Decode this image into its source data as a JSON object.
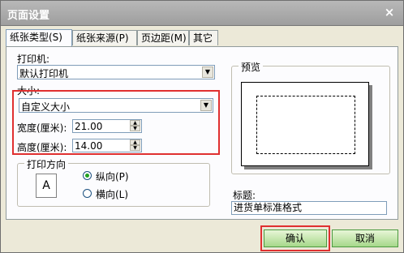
{
  "window": {
    "title": "页面设置",
    "close_glyph": "×"
  },
  "tabs": [
    {
      "label": "纸张类型(S)"
    },
    {
      "label": "纸张来源(P)"
    },
    {
      "label": "页边距(M)"
    },
    {
      "label": "其它"
    }
  ],
  "printer": {
    "label": "打印机:",
    "value": "默认打印机"
  },
  "size": {
    "label": "大小:",
    "value": "自定义大小"
  },
  "width": {
    "label": "宽度(厘米):",
    "value": "21.00"
  },
  "height": {
    "label": "高度(厘米):",
    "value": "14.00"
  },
  "orientation": {
    "label": "打印方向",
    "icon_letter": "A",
    "options": [
      {
        "label": "纵向(P)",
        "selected": true
      },
      {
        "label": "横向(L)",
        "selected": false
      }
    ]
  },
  "preview": {
    "label": "预览"
  },
  "title_field": {
    "label": "标题:",
    "value": "进货单标准格式"
  },
  "buttons": {
    "ok": "确认",
    "cancel": "取消"
  },
  "colors": {
    "highlight": "#e03030",
    "button_green": "#a6d88a"
  }
}
